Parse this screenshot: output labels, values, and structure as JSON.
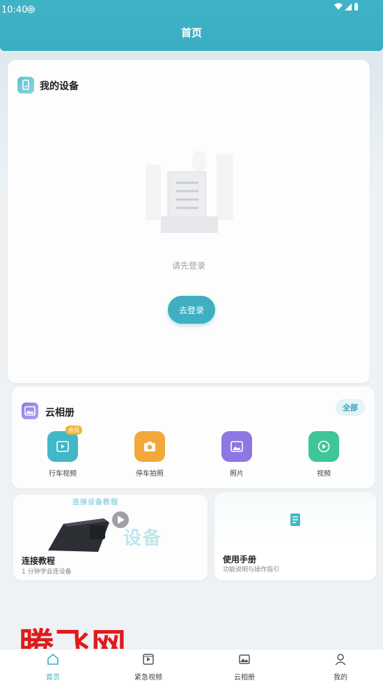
{
  "status_bar": {
    "time": "10:40"
  },
  "header": {
    "title": "首页"
  },
  "device_section": {
    "title": "我的设备",
    "empty_hint": "请先登录",
    "login_button": "去登录"
  },
  "album_section": {
    "title": "云相册",
    "all_button": "全部",
    "items": [
      {
        "label": "行车视频",
        "badge": "会员",
        "icon": "film-icon",
        "color": "#43b7c7"
      },
      {
        "label": "停车拍照",
        "icon": "camera-icon",
        "color": "#f2a93a"
      },
      {
        "label": "照片",
        "icon": "photo-icon",
        "color": "#8d77e2"
      },
      {
        "label": "视频",
        "icon": "play-icon",
        "color": "#3ec59a"
      }
    ]
  },
  "tutorial_card": {
    "title": "连接教程",
    "subtitle": "1 分钟学会连设备",
    "banner_text": "连接设备教程",
    "watermark_text": "设备"
  },
  "manual_card": {
    "title": "使用手册",
    "subtitle": "功能说明与操作指引"
  },
  "watermark": {
    "text": "腾飞网"
  },
  "bottom_nav": [
    {
      "label": "首页",
      "icon": "home-icon",
      "active": true
    },
    {
      "label": "紧急视频",
      "icon": "video-icon",
      "active": false
    },
    {
      "label": "云相册",
      "icon": "album-icon",
      "active": false
    },
    {
      "label": "我的",
      "icon": "profile-icon",
      "active": false
    }
  ],
  "colors": {
    "accent": "#3fafc1",
    "header": "#3fb2c6",
    "watermark": "#e11a1a"
  }
}
